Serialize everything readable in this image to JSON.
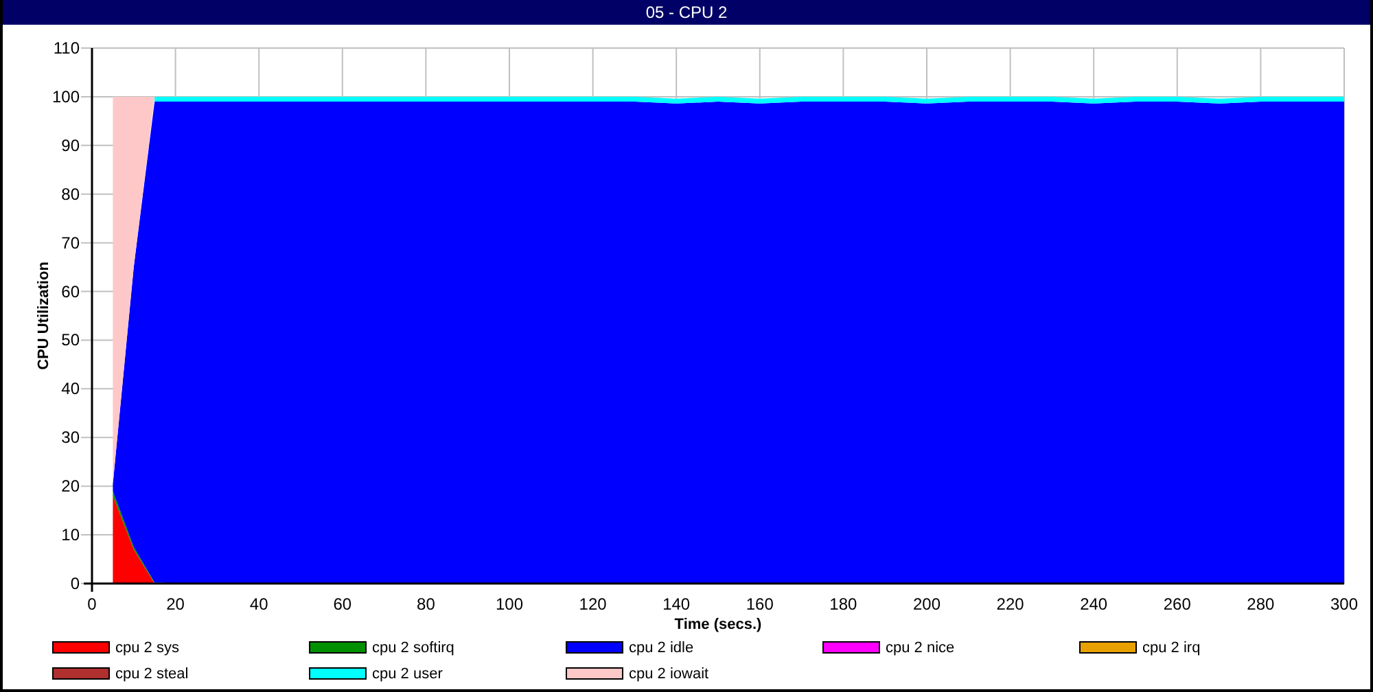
{
  "window": {
    "title": "05 - CPU 2"
  },
  "chart": {
    "chart_data": {
      "type": "area",
      "stacked": true,
      "grid": true,
      "xlabel": "Time (secs.)",
      "ylabel": "CPU Utilization",
      "xlim": [
        0,
        300
      ],
      "ylim": [
        0,
        110
      ],
      "xticks": [
        0,
        20,
        40,
        60,
        80,
        100,
        120,
        140,
        160,
        180,
        200,
        220,
        240,
        260,
        280,
        300
      ],
      "yticks": [
        0,
        10,
        20,
        30,
        40,
        50,
        60,
        70,
        80,
        90,
        100,
        110
      ],
      "x": [
        5,
        10,
        15,
        20,
        30,
        40,
        50,
        60,
        70,
        80,
        90,
        100,
        110,
        120,
        130,
        140,
        150,
        160,
        170,
        180,
        190,
        200,
        210,
        220,
        230,
        240,
        250,
        260,
        270,
        280,
        290,
        300
      ],
      "series": [
        {
          "name": "cpu 2 sys",
          "color": "#ff0000",
          "values": [
            18,
            7,
            0,
            0,
            0,
            0,
            0,
            0,
            0,
            0,
            0,
            0,
            0,
            0,
            0,
            0,
            0,
            0,
            0,
            0,
            0,
            0,
            0,
            0,
            0,
            0,
            0,
            0,
            0,
            0,
            0,
            0
          ]
        },
        {
          "name": "cpu 2 softirq",
          "color": "#009000",
          "values": [
            1,
            0.5,
            0.2,
            0.1,
            0.1,
            0.1,
            0.1,
            0.1,
            0.1,
            0.1,
            0.1,
            0.1,
            0.1,
            0.1,
            0.1,
            0.1,
            0.1,
            0.1,
            0.1,
            0.1,
            0.1,
            0.1,
            0.1,
            0.1,
            0.1,
            0.1,
            0.1,
            0.1,
            0.1,
            0.1,
            0.1,
            0.1
          ]
        },
        {
          "name": "cpu 2 idle",
          "color": "#0000ff",
          "values": [
            1.5,
            57.5,
            98.8,
            98.9,
            98.9,
            98.9,
            98.9,
            98.9,
            98.9,
            98.9,
            98.9,
            98.9,
            98.9,
            98.9,
            98.9,
            98.5,
            98.9,
            98.5,
            98.9,
            98.9,
            98.9,
            98.5,
            98.9,
            98.9,
            98.9,
            98.5,
            98.9,
            98.9,
            98.5,
            98.9,
            98.9,
            98.9
          ]
        },
        {
          "name": "cpu 2 nice",
          "color": "#ff00ff",
          "values": [
            null,
            null,
            null,
            null,
            null,
            null,
            null,
            null,
            null,
            null,
            null,
            null,
            null,
            null,
            null,
            null,
            null,
            null,
            null,
            null,
            null,
            null,
            null,
            null,
            null,
            null,
            null,
            null,
            null,
            null,
            null,
            null
          ]
        },
        {
          "name": "cpu 2 irq",
          "color": "#e8a000",
          "values": [
            null,
            null,
            null,
            null,
            null,
            null,
            null,
            null,
            null,
            null,
            null,
            null,
            null,
            null,
            null,
            null,
            null,
            null,
            null,
            null,
            null,
            null,
            null,
            null,
            null,
            null,
            null,
            null,
            null,
            null,
            null,
            null
          ]
        },
        {
          "name": "cpu 2 steal",
          "color": "#b03030",
          "values": [
            null,
            null,
            null,
            null,
            null,
            null,
            null,
            null,
            null,
            null,
            null,
            null,
            null,
            null,
            null,
            null,
            null,
            null,
            null,
            null,
            null,
            null,
            null,
            null,
            null,
            null,
            null,
            null,
            null,
            null,
            null,
            null
          ]
        },
        {
          "name": "cpu 2 user",
          "color": "#00ffff",
          "values": [
            null,
            null,
            1,
            1,
            1,
            1,
            1,
            1,
            1,
            1,
            1,
            1,
            1,
            1,
            1,
            1,
            1,
            1,
            1,
            1,
            1,
            1,
            1,
            1,
            1,
            1,
            1,
            1,
            1,
            1,
            1,
            1
          ]
        },
        {
          "name": "cpu 2 iowait",
          "color": "#ffc8c8",
          "values": [
            79.5,
            35,
            0,
            null,
            null,
            null,
            null,
            null,
            null,
            null,
            null,
            null,
            null,
            null,
            null,
            null,
            null,
            null,
            null,
            null,
            null,
            null,
            null,
            null,
            null,
            null,
            null,
            null,
            null,
            null,
            null,
            null
          ]
        }
      ]
    }
  }
}
